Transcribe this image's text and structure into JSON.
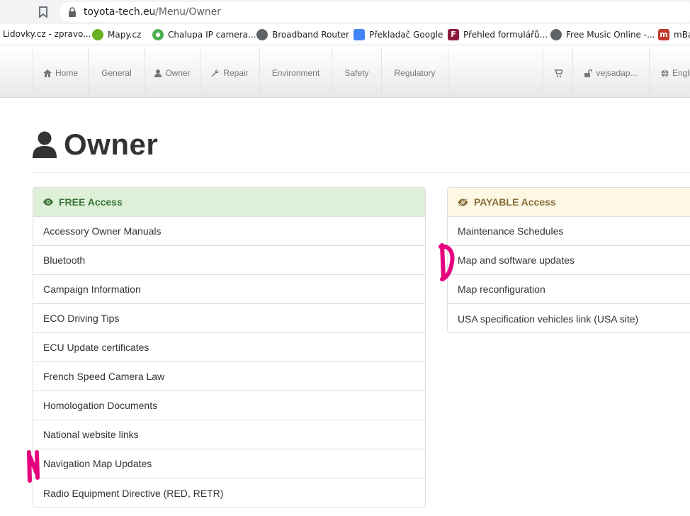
{
  "browser": {
    "url_host": "toyota-tech.eu",
    "url_path": "/Menu/Owner"
  },
  "bookmarks": [
    {
      "label": "Lidovky.cz - zpravo...",
      "color": "#ffffff"
    },
    {
      "label": "Mapy.cz",
      "color": "#6ab023"
    },
    {
      "label": "Chalupa IP camera...",
      "color": "#4caf50"
    },
    {
      "label": "Broadband Router",
      "color": "#5f6368"
    },
    {
      "label": "Překladač Google",
      "color": "#4285f4"
    },
    {
      "label": "Přehled formulářů...",
      "color": "#8b1a3a"
    },
    {
      "label": "Free Music Online -...",
      "color": "#5f6368"
    },
    {
      "label": "mBa",
      "color": "#c0392b"
    }
  ],
  "navbar": {
    "home": "Home",
    "general": "General",
    "owner": "Owner",
    "repair": "Repair",
    "environment": "Environment",
    "safety": "Safety",
    "regulatory": "Regulatory",
    "user": "vejsadap...",
    "language": "Englis"
  },
  "page": {
    "title": "Owner"
  },
  "free_panel": {
    "heading": "FREE Access",
    "items": [
      "Accessory Owner Manuals",
      "Bluetooth",
      "Campaign Information",
      "ECO Driving Tips",
      "ECU Update certificates",
      "French Speed Camera Law",
      "Homologation Documents",
      "National website links",
      "Navigation Map Updates",
      "Radio Equipment Directive (RED, RETR)"
    ]
  },
  "payable_panel": {
    "heading": "PAYABLE Access",
    "items": [
      "Maintenance Schedules",
      "Map and software updates",
      "Map reconfiguration",
      "USA specification vehicles link (USA site)"
    ]
  },
  "colors": {
    "free_bg": "#dff0d8",
    "free_text": "#3c763d",
    "payable_bg": "#fcf8e3",
    "payable_text": "#8a6d3b",
    "annotation": "#e6007e"
  }
}
